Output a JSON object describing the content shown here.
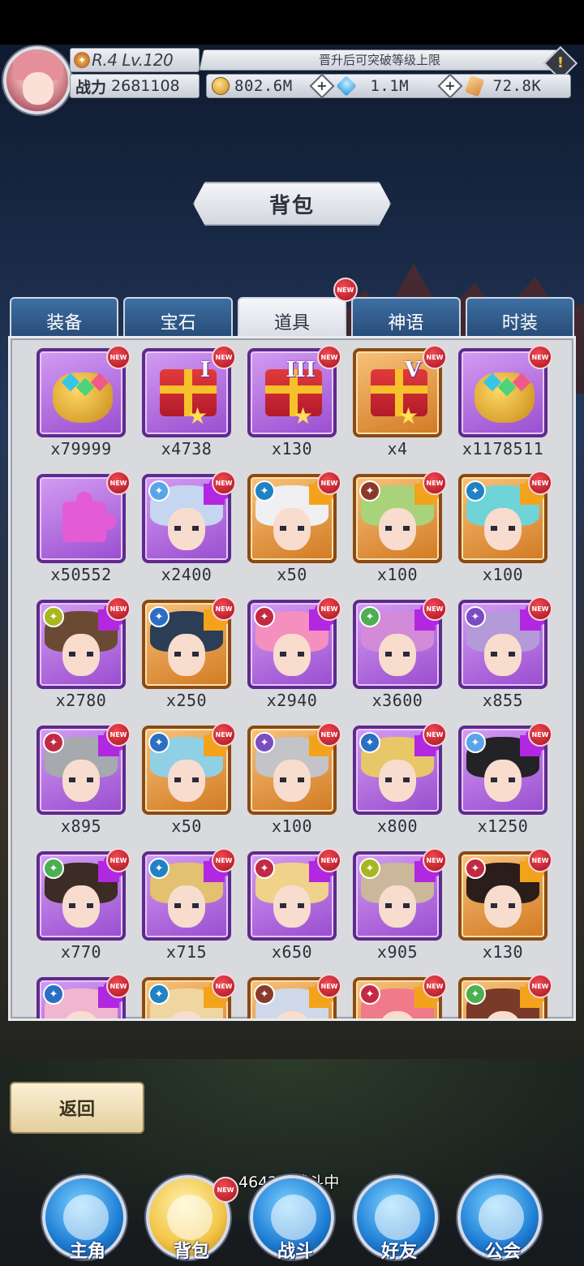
{
  "header": {
    "rank_level": "R.4 Lv.120",
    "power_label": "战力",
    "power_value": "2681108",
    "exp_notice": "晋升后可突破等级上限",
    "currencies": [
      {
        "icon": "gold-coin-icon",
        "value": "802.6M"
      },
      {
        "icon": "diamond-icon",
        "value": "1.1M"
      },
      {
        "icon": "card-icon",
        "value": "72.8K"
      }
    ]
  },
  "title": "背包",
  "tabs": [
    {
      "label": "装备",
      "active": false
    },
    {
      "label": "宝石",
      "active": false
    },
    {
      "label": "道具",
      "active": true,
      "new": "NEW"
    },
    {
      "label": "神语",
      "active": false
    },
    {
      "label": "时装",
      "active": false
    }
  ],
  "new_badge": "NEW",
  "items": [
    {
      "type": "bag",
      "rarity": "purple",
      "qty": "x79999"
    },
    {
      "type": "gift",
      "rarity": "purple",
      "roman": "I",
      "qty": "x4738"
    },
    {
      "type": "gift",
      "rarity": "purple",
      "roman": "III",
      "qty": "x130"
    },
    {
      "type": "gift",
      "rarity": "orange",
      "roman": "V",
      "qty": "x4"
    },
    {
      "type": "bag",
      "rarity": "purple",
      "qty": "x1178511"
    },
    {
      "type": "piece",
      "rarity": "purple",
      "qty": "x50552"
    },
    {
      "type": "hero",
      "rarity": "purple",
      "hair": "#c6d6f0",
      "role": "#5aa5e8",
      "qty": "x2400"
    },
    {
      "type": "hero",
      "rarity": "orange",
      "hair": "#f0eff2",
      "role": "#1f82c4",
      "qty": "x50"
    },
    {
      "type": "hero",
      "rarity": "orange",
      "hair": "#a8d37a",
      "role": "#8a3a2a",
      "qty": "x100"
    },
    {
      "type": "hero",
      "rarity": "orange",
      "hair": "#6fd4d8",
      "role": "#1f82c4",
      "qty": "x100"
    },
    {
      "type": "hero",
      "rarity": "purple",
      "hair": "#6b4a34",
      "role": "#a7b81e",
      "qty": "x2780"
    },
    {
      "type": "hero",
      "rarity": "orange",
      "hair": "#2b3e55",
      "role": "#2a6fc4",
      "qty": "x250"
    },
    {
      "type": "hero",
      "rarity": "purple",
      "hair": "#f48fc0",
      "role": "#c22a44",
      "qty": "x2940"
    },
    {
      "type": "hero",
      "rarity": "purple",
      "hair": "#d38ad8",
      "role": "#4caf50",
      "qty": "x3600"
    },
    {
      "type": "hero",
      "rarity": "purple",
      "hair": "#b49ad9",
      "role": "#7b4dc2",
      "qty": "x855"
    },
    {
      "type": "hero",
      "rarity": "purple",
      "hair": "#a6a9ad",
      "role": "#c22a44",
      "qty": "x895"
    },
    {
      "type": "hero",
      "rarity": "orange",
      "hair": "#8fd0e4",
      "role": "#2a6fc4",
      "qty": "x50"
    },
    {
      "type": "hero",
      "rarity": "orange",
      "hair": "#c4c4c8",
      "role": "#7b4dc2",
      "qty": "x100"
    },
    {
      "type": "hero",
      "rarity": "purple",
      "hair": "#e8c768",
      "role": "#2a6fc4",
      "qty": "x800"
    },
    {
      "type": "hero",
      "rarity": "purple",
      "hair": "#232327",
      "role": "#5aa5e8",
      "qty": "x1250"
    },
    {
      "type": "hero",
      "rarity": "purple",
      "hair": "#3b2c25",
      "role": "#4caf50",
      "qty": "x770"
    },
    {
      "type": "hero",
      "rarity": "purple",
      "hair": "#e2c170",
      "role": "#1f82c4",
      "qty": "x715"
    },
    {
      "type": "hero",
      "rarity": "purple",
      "hair": "#f0d28a",
      "role": "#c22a44",
      "qty": "x650"
    },
    {
      "type": "hero",
      "rarity": "purple",
      "hair": "#cbb79a",
      "role": "#a7b81e",
      "qty": "x905"
    },
    {
      "type": "hero",
      "rarity": "orange",
      "hair": "#2b1d1a",
      "role": "#c22a44",
      "qty": "x130"
    },
    {
      "type": "hero",
      "rarity": "purple",
      "hair": "#f2b5cf",
      "role": "#2a6fc4",
      "qty": ""
    },
    {
      "type": "hero",
      "rarity": "orange",
      "hair": "#efd6a0",
      "role": "#1f82c4",
      "qty": ""
    },
    {
      "type": "hero",
      "rarity": "orange",
      "hair": "#cfd8e8",
      "role": "#8a3a2a",
      "qty": ""
    },
    {
      "type": "hero",
      "rarity": "orange",
      "hair": "#f07a8a",
      "role": "#c22a44",
      "qty": ""
    },
    {
      "type": "hero",
      "rarity": "orange",
      "hair": "#7a3a2a",
      "role": "#4caf50",
      "qty": ""
    }
  ],
  "back_button": "返回",
  "battle_status": "4642层战斗中",
  "nav": [
    {
      "label": "主角",
      "icon": "helmet-icon",
      "active": false
    },
    {
      "label": "背包",
      "icon": "backpack-icon",
      "active": true,
      "new": "NEW"
    },
    {
      "label": "战斗",
      "icon": "crossed-swords-icon",
      "active": false
    },
    {
      "label": "好友",
      "icon": "handshake-icon",
      "active": false
    },
    {
      "label": "公会",
      "icon": "guild-crest-icon",
      "active": false
    }
  ]
}
